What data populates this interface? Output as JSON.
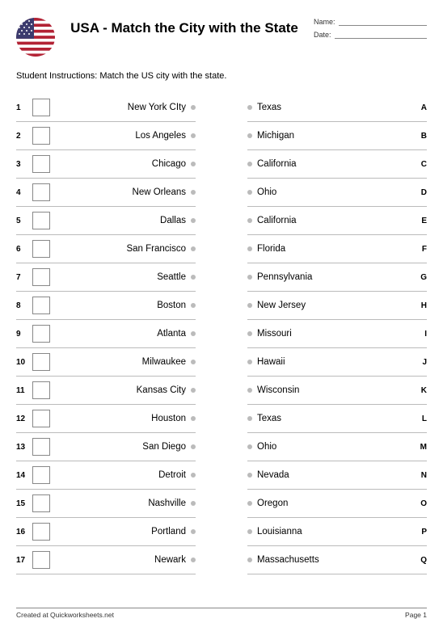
{
  "title": "USA - Match the City with the State",
  "meta": {
    "name_label": "Name:",
    "date_label": "Date:"
  },
  "instructions": "Student Instructions: Match the US city with the state.",
  "left": [
    {
      "n": "1",
      "label": "New York CIty"
    },
    {
      "n": "2",
      "label": "Los Angeles"
    },
    {
      "n": "3",
      "label": "Chicago"
    },
    {
      "n": "4",
      "label": "New Orleans"
    },
    {
      "n": "5",
      "label": "Dallas"
    },
    {
      "n": "6",
      "label": "San Francisco"
    },
    {
      "n": "7",
      "label": "Seattle"
    },
    {
      "n": "8",
      "label": "Boston"
    },
    {
      "n": "9",
      "label": "Atlanta"
    },
    {
      "n": "10",
      "label": "Milwaukee"
    },
    {
      "n": "11",
      "label": "Kansas City"
    },
    {
      "n": "12",
      "label": "Houston"
    },
    {
      "n": "13",
      "label": "San Diego"
    },
    {
      "n": "14",
      "label": "Detroit"
    },
    {
      "n": "15",
      "label": "Nashville"
    },
    {
      "n": "16",
      "label": "Portland"
    },
    {
      "n": "17",
      "label": "Newark"
    }
  ],
  "right": [
    {
      "letter": "A",
      "label": "Texas"
    },
    {
      "letter": "B",
      "label": "Michigan"
    },
    {
      "letter": "C",
      "label": "California"
    },
    {
      "letter": "D",
      "label": "Ohio"
    },
    {
      "letter": "E",
      "label": "California"
    },
    {
      "letter": "F",
      "label": "Florida"
    },
    {
      "letter": "G",
      "label": "Pennsylvania"
    },
    {
      "letter": "H",
      "label": "New Jersey"
    },
    {
      "letter": "I",
      "label": "Missouri"
    },
    {
      "letter": "J",
      "label": "Hawaii"
    },
    {
      "letter": "K",
      "label": "Wisconsin"
    },
    {
      "letter": "L",
      "label": "Texas"
    },
    {
      "letter": "M",
      "label": "Ohio"
    },
    {
      "letter": "N",
      "label": "Nevada"
    },
    {
      "letter": "O",
      "label": "Oregon"
    },
    {
      "letter": "P",
      "label": "Louisianna"
    },
    {
      "letter": "Q",
      "label": "Massachusetts"
    }
  ],
  "footer": {
    "credit": "Created at Quickworksheets.net",
    "page": "Page 1"
  }
}
